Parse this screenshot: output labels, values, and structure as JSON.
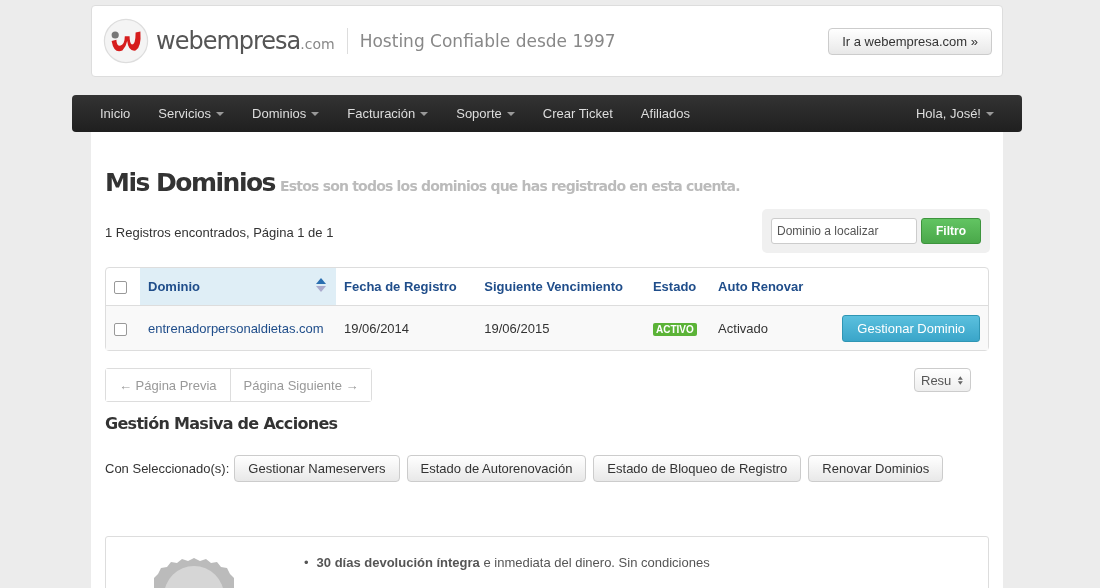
{
  "header": {
    "brand": "webempresa",
    "brand_suffix": ".com",
    "tagline": "Hosting Confiable desde 1997",
    "site_button": "Ir a webempresa.com »"
  },
  "nav": {
    "items": [
      {
        "label": "Inicio",
        "dropdown": false
      },
      {
        "label": "Servicios",
        "dropdown": true
      },
      {
        "label": "Dominios",
        "dropdown": true
      },
      {
        "label": "Facturación",
        "dropdown": true
      },
      {
        "label": "Soporte",
        "dropdown": true
      },
      {
        "label": "Crear Ticket",
        "dropdown": false
      },
      {
        "label": "Afiliados",
        "dropdown": false
      }
    ],
    "user": {
      "label": "Hola, José!",
      "dropdown": true
    }
  },
  "page": {
    "title": "Mis Dominios",
    "subtitle": "Estos son todos los dominios que has registrado en esta cuenta."
  },
  "records": "1 Registros encontrados, Página 1 de 1",
  "filter": {
    "placeholder": "Dominio a localizar",
    "button": "Filtro"
  },
  "table": {
    "select_all_checked": false,
    "columns": [
      {
        "label": "Dominio",
        "sorted": true
      },
      {
        "label": "Fecha de Registro",
        "sorted": false
      },
      {
        "label": "Siguiente Vencimiento",
        "sorted": false
      },
      {
        "label": "Estado",
        "sorted": false
      },
      {
        "label": "Auto Renovar",
        "sorted": false
      }
    ],
    "rows": [
      {
        "checked": false,
        "domain": "entrenadorpersonaldietas.com",
        "registered": "19/06/2014",
        "expires": "19/06/2015",
        "status": "ACTIVO",
        "color": "#5bb337",
        "auto_renew": "Activado",
        "action": "Gestionar Dominio"
      }
    ]
  },
  "pagination": {
    "prev": "← Página Previa",
    "next": "Página Siguiente →",
    "prev_disabled": true,
    "next_disabled": true,
    "results_select": "Resu"
  },
  "bulk": {
    "title": "Gestión Masiva de Acciones",
    "label": "Con Seleccionado(s):",
    "buttons": [
      "Gestionar Nameservers",
      "Estado de Autorenovación",
      "Estado de Bloqueo de Registro",
      "Renovar Dominios"
    ]
  },
  "guarantee": {
    "bullet": "•",
    "items": [
      "**30 días devolución íntegra** e inmediata del dinero. Sin condiciones"
    ]
  }
}
